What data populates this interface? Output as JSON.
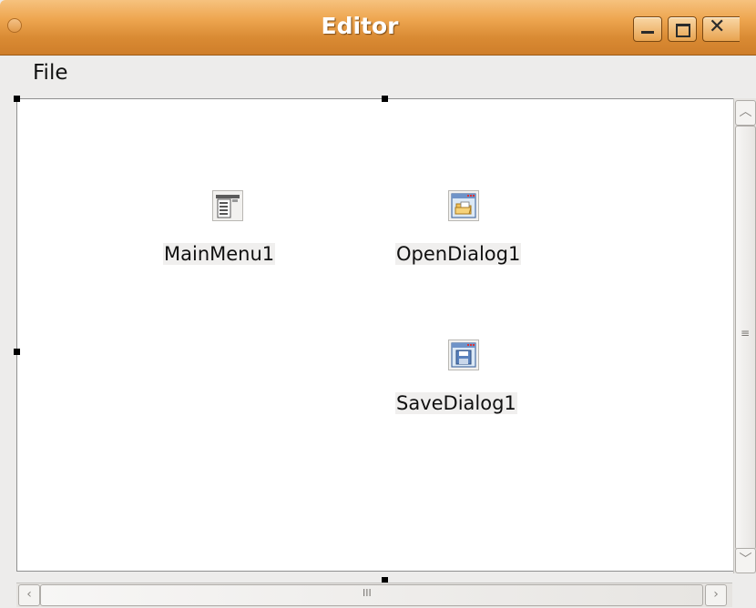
{
  "window": {
    "title": "Editor",
    "buttons": {
      "minimize": "minimize",
      "maximize": "maximize",
      "close": "close"
    }
  },
  "menu": {
    "items": [
      {
        "label": "File"
      }
    ]
  },
  "components": [
    {
      "name": "MainMenu1",
      "icon": "main-menu-icon"
    },
    {
      "name": "OpenDialog1",
      "icon": "open-dialog-icon"
    },
    {
      "name": "SaveDialog1",
      "icon": "save-dialog-icon"
    }
  ],
  "scrollbars": {
    "vertical": {
      "grip": "≡"
    },
    "horizontal": {
      "grip": "III"
    }
  },
  "colors": {
    "titlebar": "#e69b45",
    "canvas": "#ffffff",
    "chrome": "#edeceb"
  }
}
